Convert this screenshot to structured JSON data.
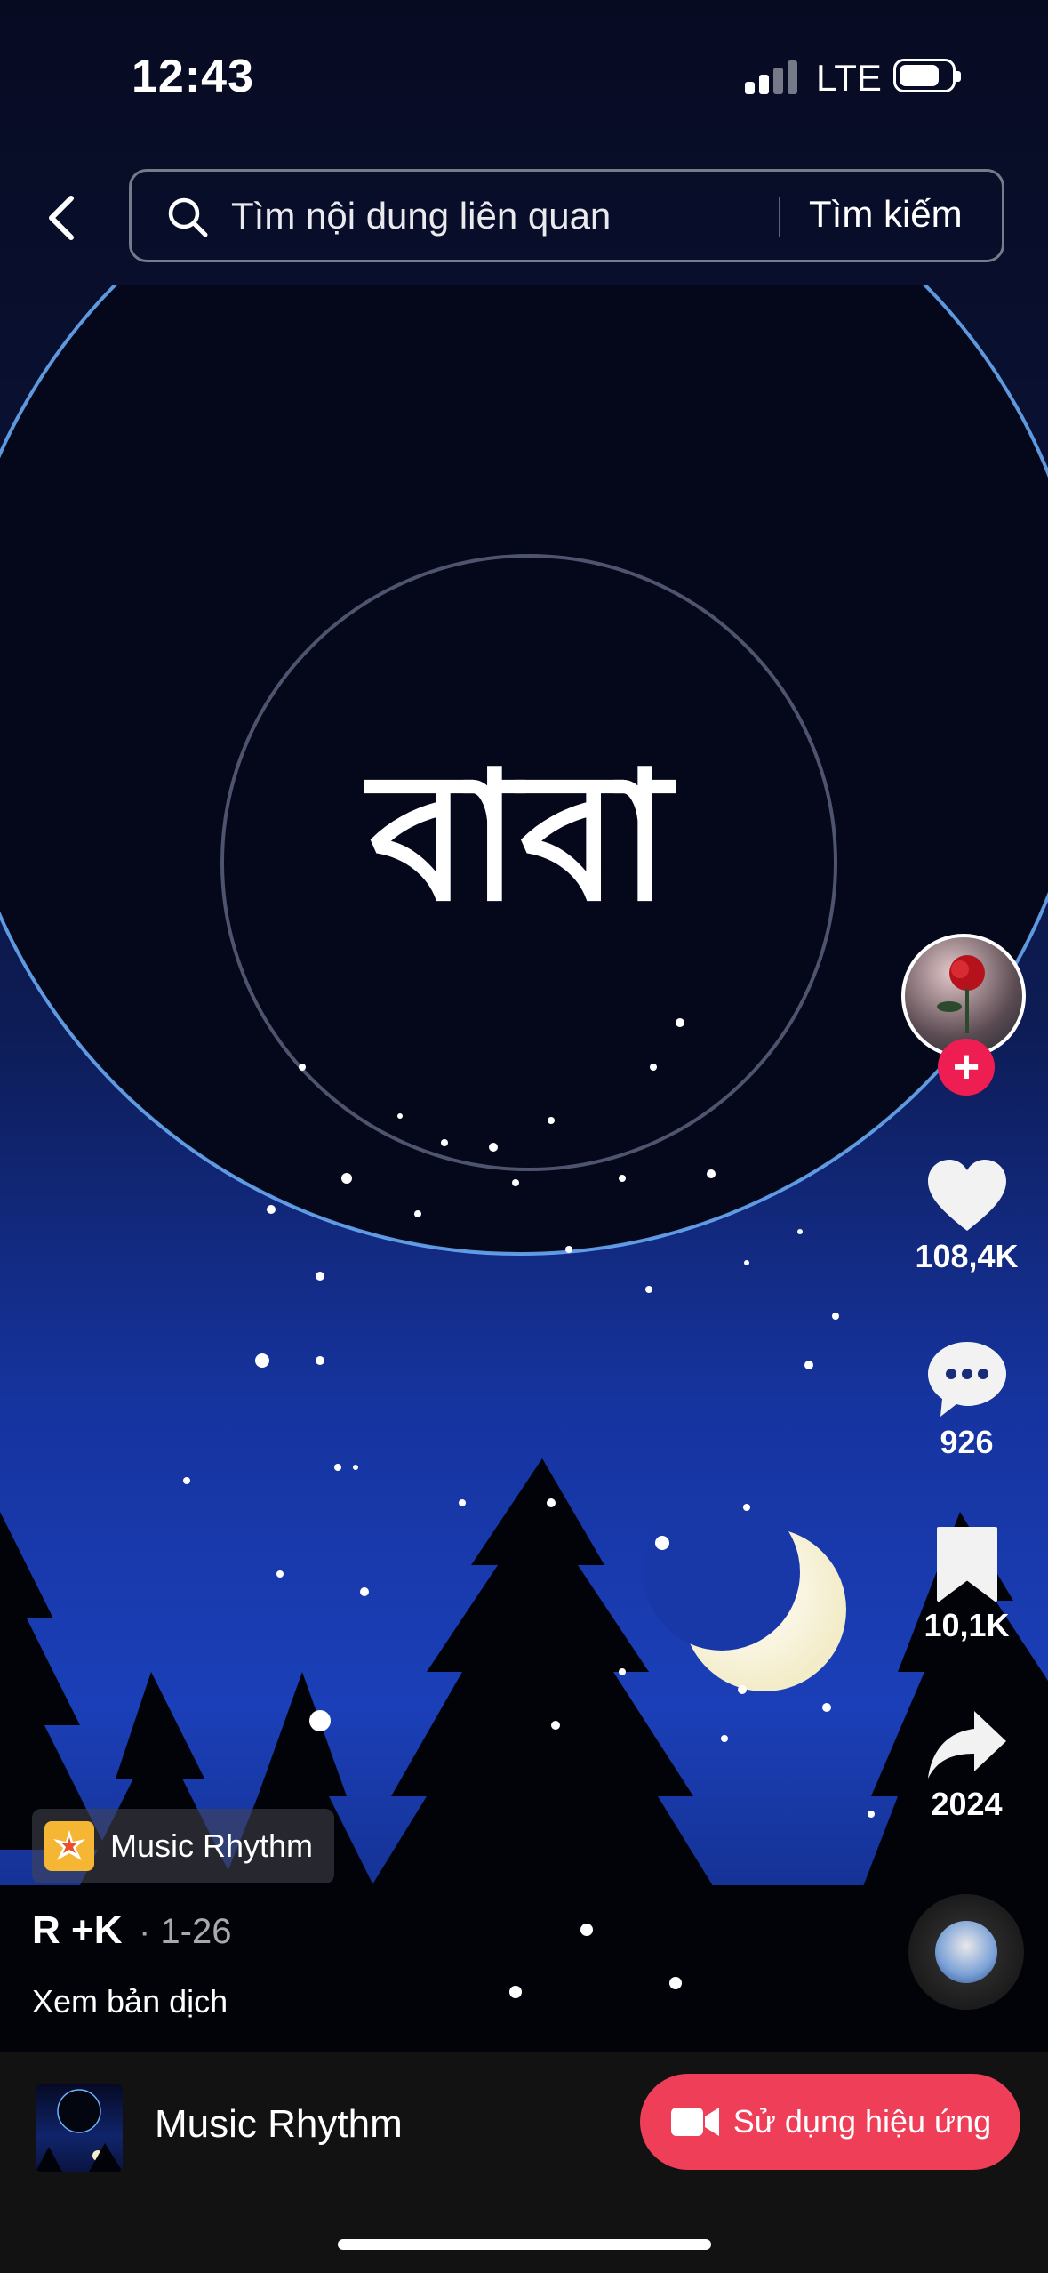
{
  "status_bar": {
    "time": "12:43",
    "network": "LTE"
  },
  "search": {
    "placeholder": "Tìm nội dung liên quan",
    "button_label": "Tìm kiếm"
  },
  "video": {
    "overlay_text": "বাবা"
  },
  "actions": {
    "likes": "108,4K",
    "comments": "926",
    "saves": "10,1K",
    "shares": "2024"
  },
  "caption": {
    "effect_label": "Music Rhythm",
    "author": "R +K",
    "date": "· 1-26",
    "translate_label": "Xem bản dịch"
  },
  "bottom_bar": {
    "sound_name": "Music Rhythm",
    "use_effect_label": "Sử dụng hiệu ứng"
  },
  "colors": {
    "accent": "#ee1d52",
    "use_effect_button": "#ee3e58",
    "effect_icon": "#f4b633"
  }
}
